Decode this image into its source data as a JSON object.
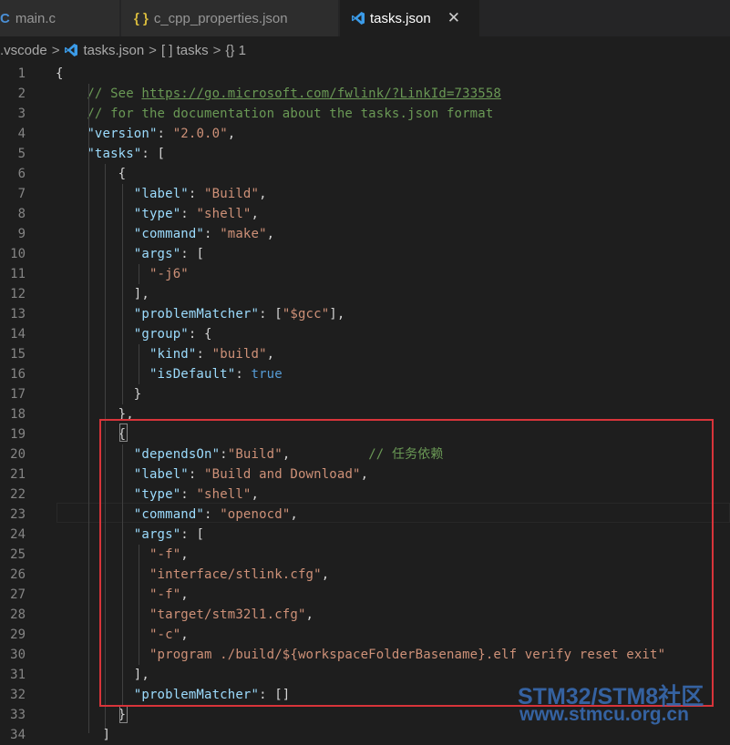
{
  "tabs": [
    {
      "icon": "C",
      "label": "main.c",
      "active": false
    },
    {
      "icon": "{ }",
      "label": "c_cpp_properties.json",
      "active": false
    },
    {
      "icon": "vscode",
      "label": "tasks.json",
      "active": true,
      "close": "✕"
    }
  ],
  "breadcrumb": [
    ".vscode",
    "tasks.json",
    "[ ] tasks",
    "{} 1"
  ],
  "lines": [
    {
      "n": "1",
      "code": "{"
    },
    {
      "n": "2",
      "code": "    // See https://go.microsoft.com/fwlink/?LinkId=733558"
    },
    {
      "n": "3",
      "code": "    // for the documentation about the tasks.json format"
    },
    {
      "n": "4",
      "code": "    \"version\": \"2.0.0\","
    },
    {
      "n": "5",
      "code": "    \"tasks\": ["
    },
    {
      "n": "6",
      "code": "        {"
    },
    {
      "n": "7",
      "code": "          \"label\": \"Build\","
    },
    {
      "n": "8",
      "code": "          \"type\": \"shell\","
    },
    {
      "n": "9",
      "code": "          \"command\": \"make\","
    },
    {
      "n": "10",
      "code": "          \"args\": ["
    },
    {
      "n": "11",
      "code": "            \"-j6\""
    },
    {
      "n": "12",
      "code": "          ],"
    },
    {
      "n": "13",
      "code": "          \"problemMatcher\": [\"$gcc\"],"
    },
    {
      "n": "14",
      "code": "          \"group\": {"
    },
    {
      "n": "15",
      "code": "            \"kind\": \"build\","
    },
    {
      "n": "16",
      "code": "            \"isDefault\": true"
    },
    {
      "n": "17",
      "code": "          }"
    },
    {
      "n": "18",
      "code": "        },"
    },
    {
      "n": "19",
      "code": "        {"
    },
    {
      "n": "20",
      "code": "          \"dependsOn\":\"Build\",          // 任务依赖"
    },
    {
      "n": "21",
      "code": "          \"label\": \"Build and Download\","
    },
    {
      "n": "22",
      "code": "          \"type\": \"shell\","
    },
    {
      "n": "23",
      "code": "          \"command\": \"openocd\","
    },
    {
      "n": "24",
      "code": "          \"args\": ["
    },
    {
      "n": "25",
      "code": "            \"-f\","
    },
    {
      "n": "26",
      "code": "            \"interface/stlink.cfg\","
    },
    {
      "n": "27",
      "code": "            \"-f\","
    },
    {
      "n": "28",
      "code": "            \"target/stm32l1.cfg\","
    },
    {
      "n": "29",
      "code": "            \"-c\","
    },
    {
      "n": "30",
      "code": "            \"program ./build/${workspaceFolderBasename}.elf verify reset exit\""
    },
    {
      "n": "31",
      "code": "          ],"
    },
    {
      "n": "32",
      "code": "          \"problemMatcher\": []"
    },
    {
      "n": "33",
      "code": "        }"
    },
    {
      "n": "34",
      "code": "      ]"
    }
  ],
  "watermark": {
    "line1": "STM32/STM8社区",
    "line2": "www.stmcu.org.cn"
  },
  "colors": {
    "key": "#9cdcfe",
    "string": "#ce9178",
    "comment": "#6a9955",
    "keyword": "#569cd6",
    "annotation_box": "#d8343a"
  }
}
